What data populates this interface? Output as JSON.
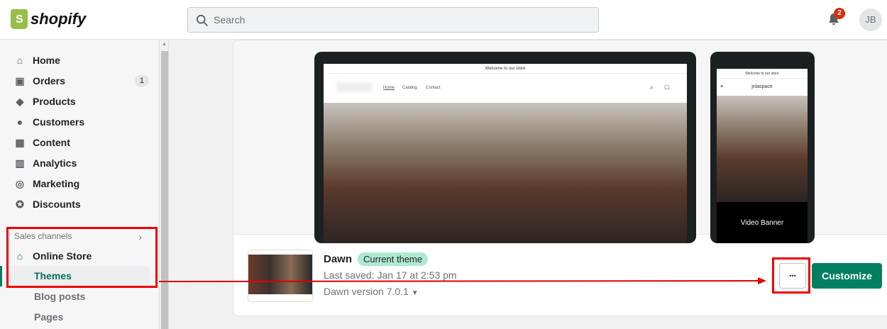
{
  "brand": "shopify",
  "search": {
    "placeholder": "Search"
  },
  "notifications": {
    "count": "2"
  },
  "user": {
    "initials": "JB"
  },
  "sidebar": {
    "items": [
      {
        "label": "Home",
        "icon": "home-icon"
      },
      {
        "label": "Orders",
        "icon": "orders-icon",
        "count": "1"
      },
      {
        "label": "Products",
        "icon": "tag-icon"
      },
      {
        "label": "Customers",
        "icon": "person-icon"
      },
      {
        "label": "Content",
        "icon": "image-icon"
      },
      {
        "label": "Analytics",
        "icon": "bar-chart-icon"
      },
      {
        "label": "Marketing",
        "icon": "target-icon"
      },
      {
        "label": "Discounts",
        "icon": "discount-icon"
      }
    ],
    "sales_channels": "Sales channels",
    "online_store": "Online Store",
    "sub_items": [
      "Themes",
      "Blog posts",
      "Pages"
    ]
  },
  "preview": {
    "announcement": "Welcome to our store",
    "nav": [
      "Home",
      "Catalog",
      "Contact"
    ],
    "mobile_store_name": "jnlaspace",
    "mobile_banner": "Video Banner"
  },
  "theme": {
    "name": "Dawn",
    "badge": "Current theme",
    "last_saved": "Last saved: Jan 17 at 2:53 pm",
    "version": "Dawn version 7.0.1",
    "more_label": "•••",
    "customize_label": "Customize"
  }
}
